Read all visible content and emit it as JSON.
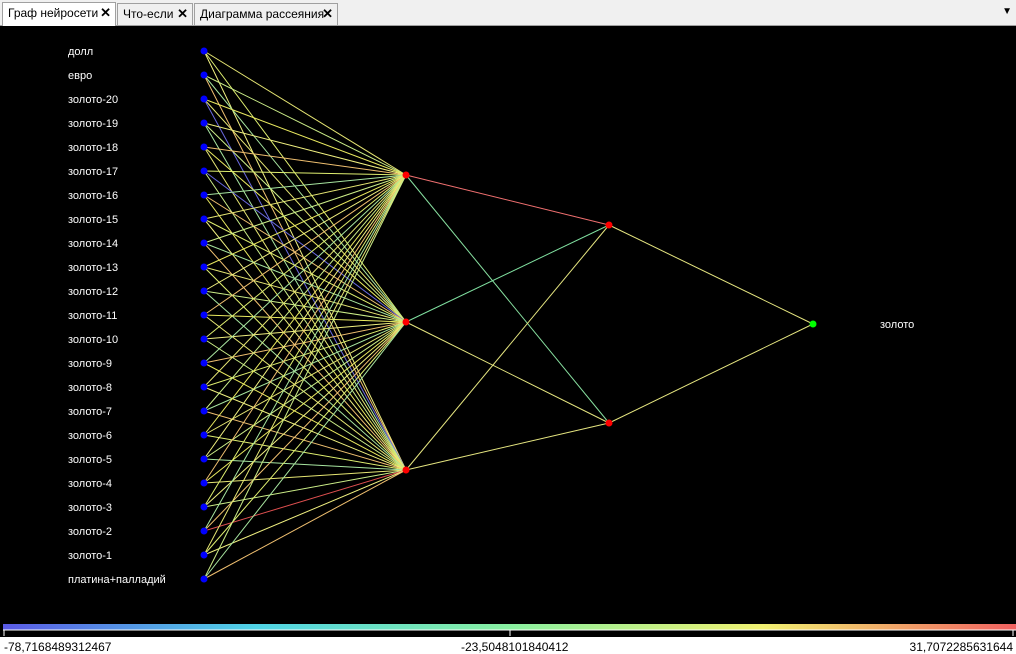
{
  "tabs": [
    {
      "label": "Граф нейросети",
      "active": true
    },
    {
      "label": "Что-если",
      "active": false
    },
    {
      "label": "Диаграмма рассеяния",
      "active": false
    }
  ],
  "inputs": [
    "долл",
    "евро",
    "золото-20",
    "золото-19",
    "золото-18",
    "золото-17",
    "золото-16",
    "золото-15",
    "золото-14",
    "золото-13",
    "золото-12",
    "золото-11",
    "золото-10",
    "золото-9",
    "золото-8",
    "золото-7",
    "золото-6",
    "золото-5",
    "золото-4",
    "золото-3",
    "золото-2",
    "золото-1",
    "платина+палладий"
  ],
  "output": "золото",
  "scale": {
    "min_label": "-78,7168489312467",
    "mid_label": "-23,5048101840412",
    "max_label": "31,7072285631644"
  },
  "colors": {
    "input_node": "#0000ff",
    "hidden_node": "#ff0000",
    "output_node": "#00ff00",
    "background": "#000000"
  }
}
